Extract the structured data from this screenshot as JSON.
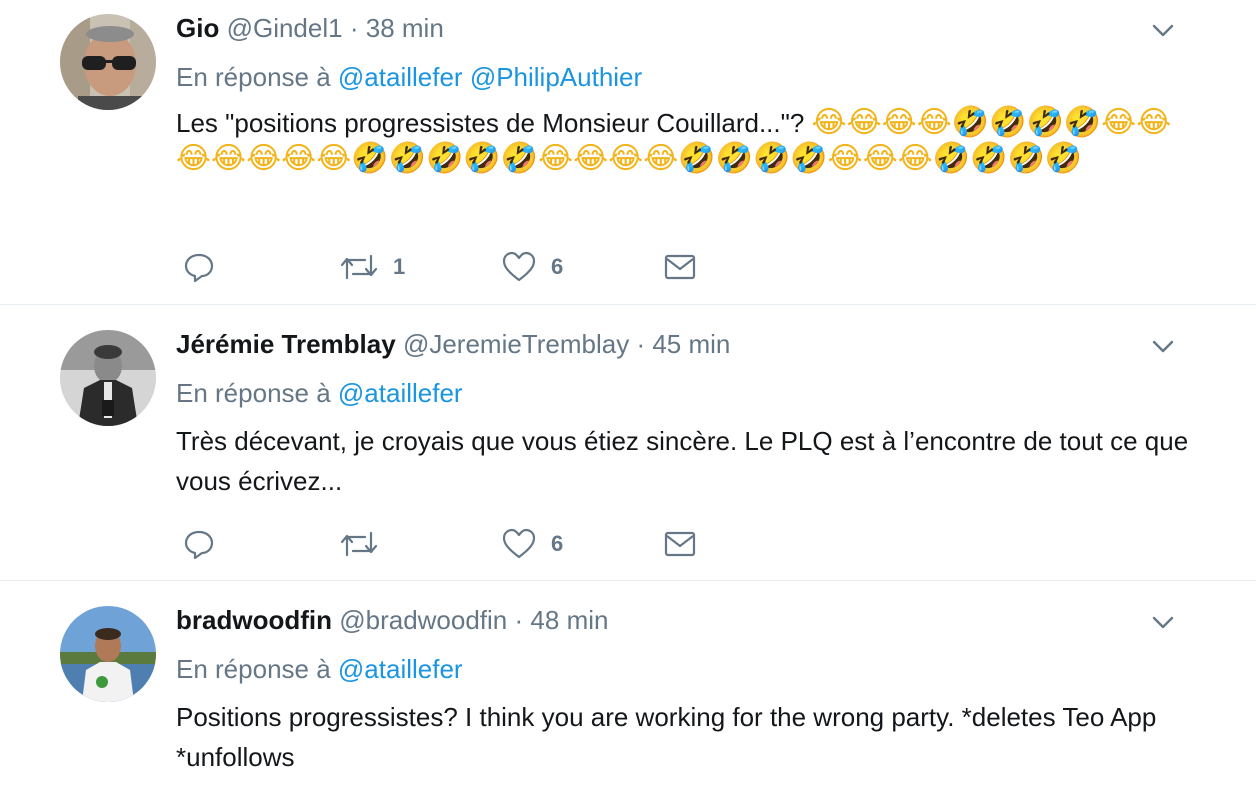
{
  "tweets": [
    {
      "name": "Gio",
      "handle": "@Gindel1",
      "separator": "·",
      "time": "38 min",
      "reply_prefix": "En réponse à",
      "mentions": [
        "@ataillefer",
        "@PhilipAuthier"
      ],
      "text": "Les \"positions progressistes de Monsieur Couillard...\"? ",
      "emoji_line": "😂😂😂😂🤣🤣🤣🤣😂😂😂😂😂😂😂🤣🤣🤣🤣🤣😂😂😂😂🤣🤣🤣🤣😂😂😂🤣🤣🤣🤣",
      "replies": "",
      "retweets": "1",
      "likes": "6"
    },
    {
      "name": "Jérémie Tremblay",
      "handle": "@JeremieTremblay",
      "separator": "·",
      "time": "45 min",
      "reply_prefix": "En réponse à",
      "mentions": [
        "@ataillefer"
      ],
      "text": "Très décevant, je croyais que vous étiez sincère. Le PLQ est à l’encontre de tout ce que vous écrivez...",
      "replies": "",
      "retweets": "",
      "likes": "6"
    },
    {
      "name": "bradwoodfin",
      "handle": "@bradwoodfin",
      "separator": "·",
      "time": "48 min",
      "reply_prefix": "En réponse à",
      "mentions": [
        "@ataillefer"
      ],
      "text": "Positions progressistes? I think you are working for the wrong party. *deletes Teo App *unfollows"
    }
  ],
  "icons": {
    "reply": "reply-icon",
    "retweet": "retweet-icon",
    "like": "heart-icon",
    "dm": "envelope-icon",
    "menu": "chevron-down-icon"
  },
  "colors": {
    "text": "#14171a",
    "muted": "#657786",
    "link": "#1b95e0",
    "divider": "#e6ecf0"
  }
}
